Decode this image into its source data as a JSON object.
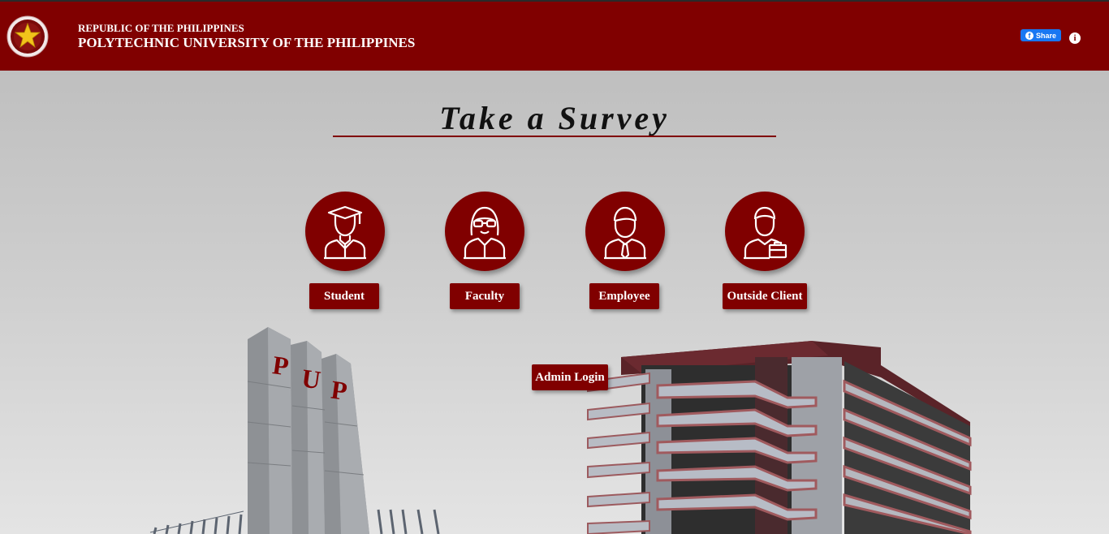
{
  "header": {
    "republic": "REPUBLIC OF THE PHILIPPINES",
    "university": "POLYTECHNIC UNIVERSITY OF THE PHILIPPINES",
    "share_label": "Share",
    "share_icon": "f",
    "info_icon": "i"
  },
  "main": {
    "title": "Take a Survey",
    "options": [
      {
        "label": "Student",
        "icon": "graduate-icon"
      },
      {
        "label": "Faculty",
        "icon": "faculty-woman-icon"
      },
      {
        "label": "Employee",
        "icon": "employee-icon"
      },
      {
        "label": "Outside Client",
        "icon": "client-briefcase-icon"
      }
    ],
    "admin_login": "Admin Login"
  },
  "background": {
    "monument_letters": [
      "P",
      "U",
      "P"
    ]
  },
  "colors": {
    "brand": "#800000",
    "facebook": "#1877f2"
  }
}
